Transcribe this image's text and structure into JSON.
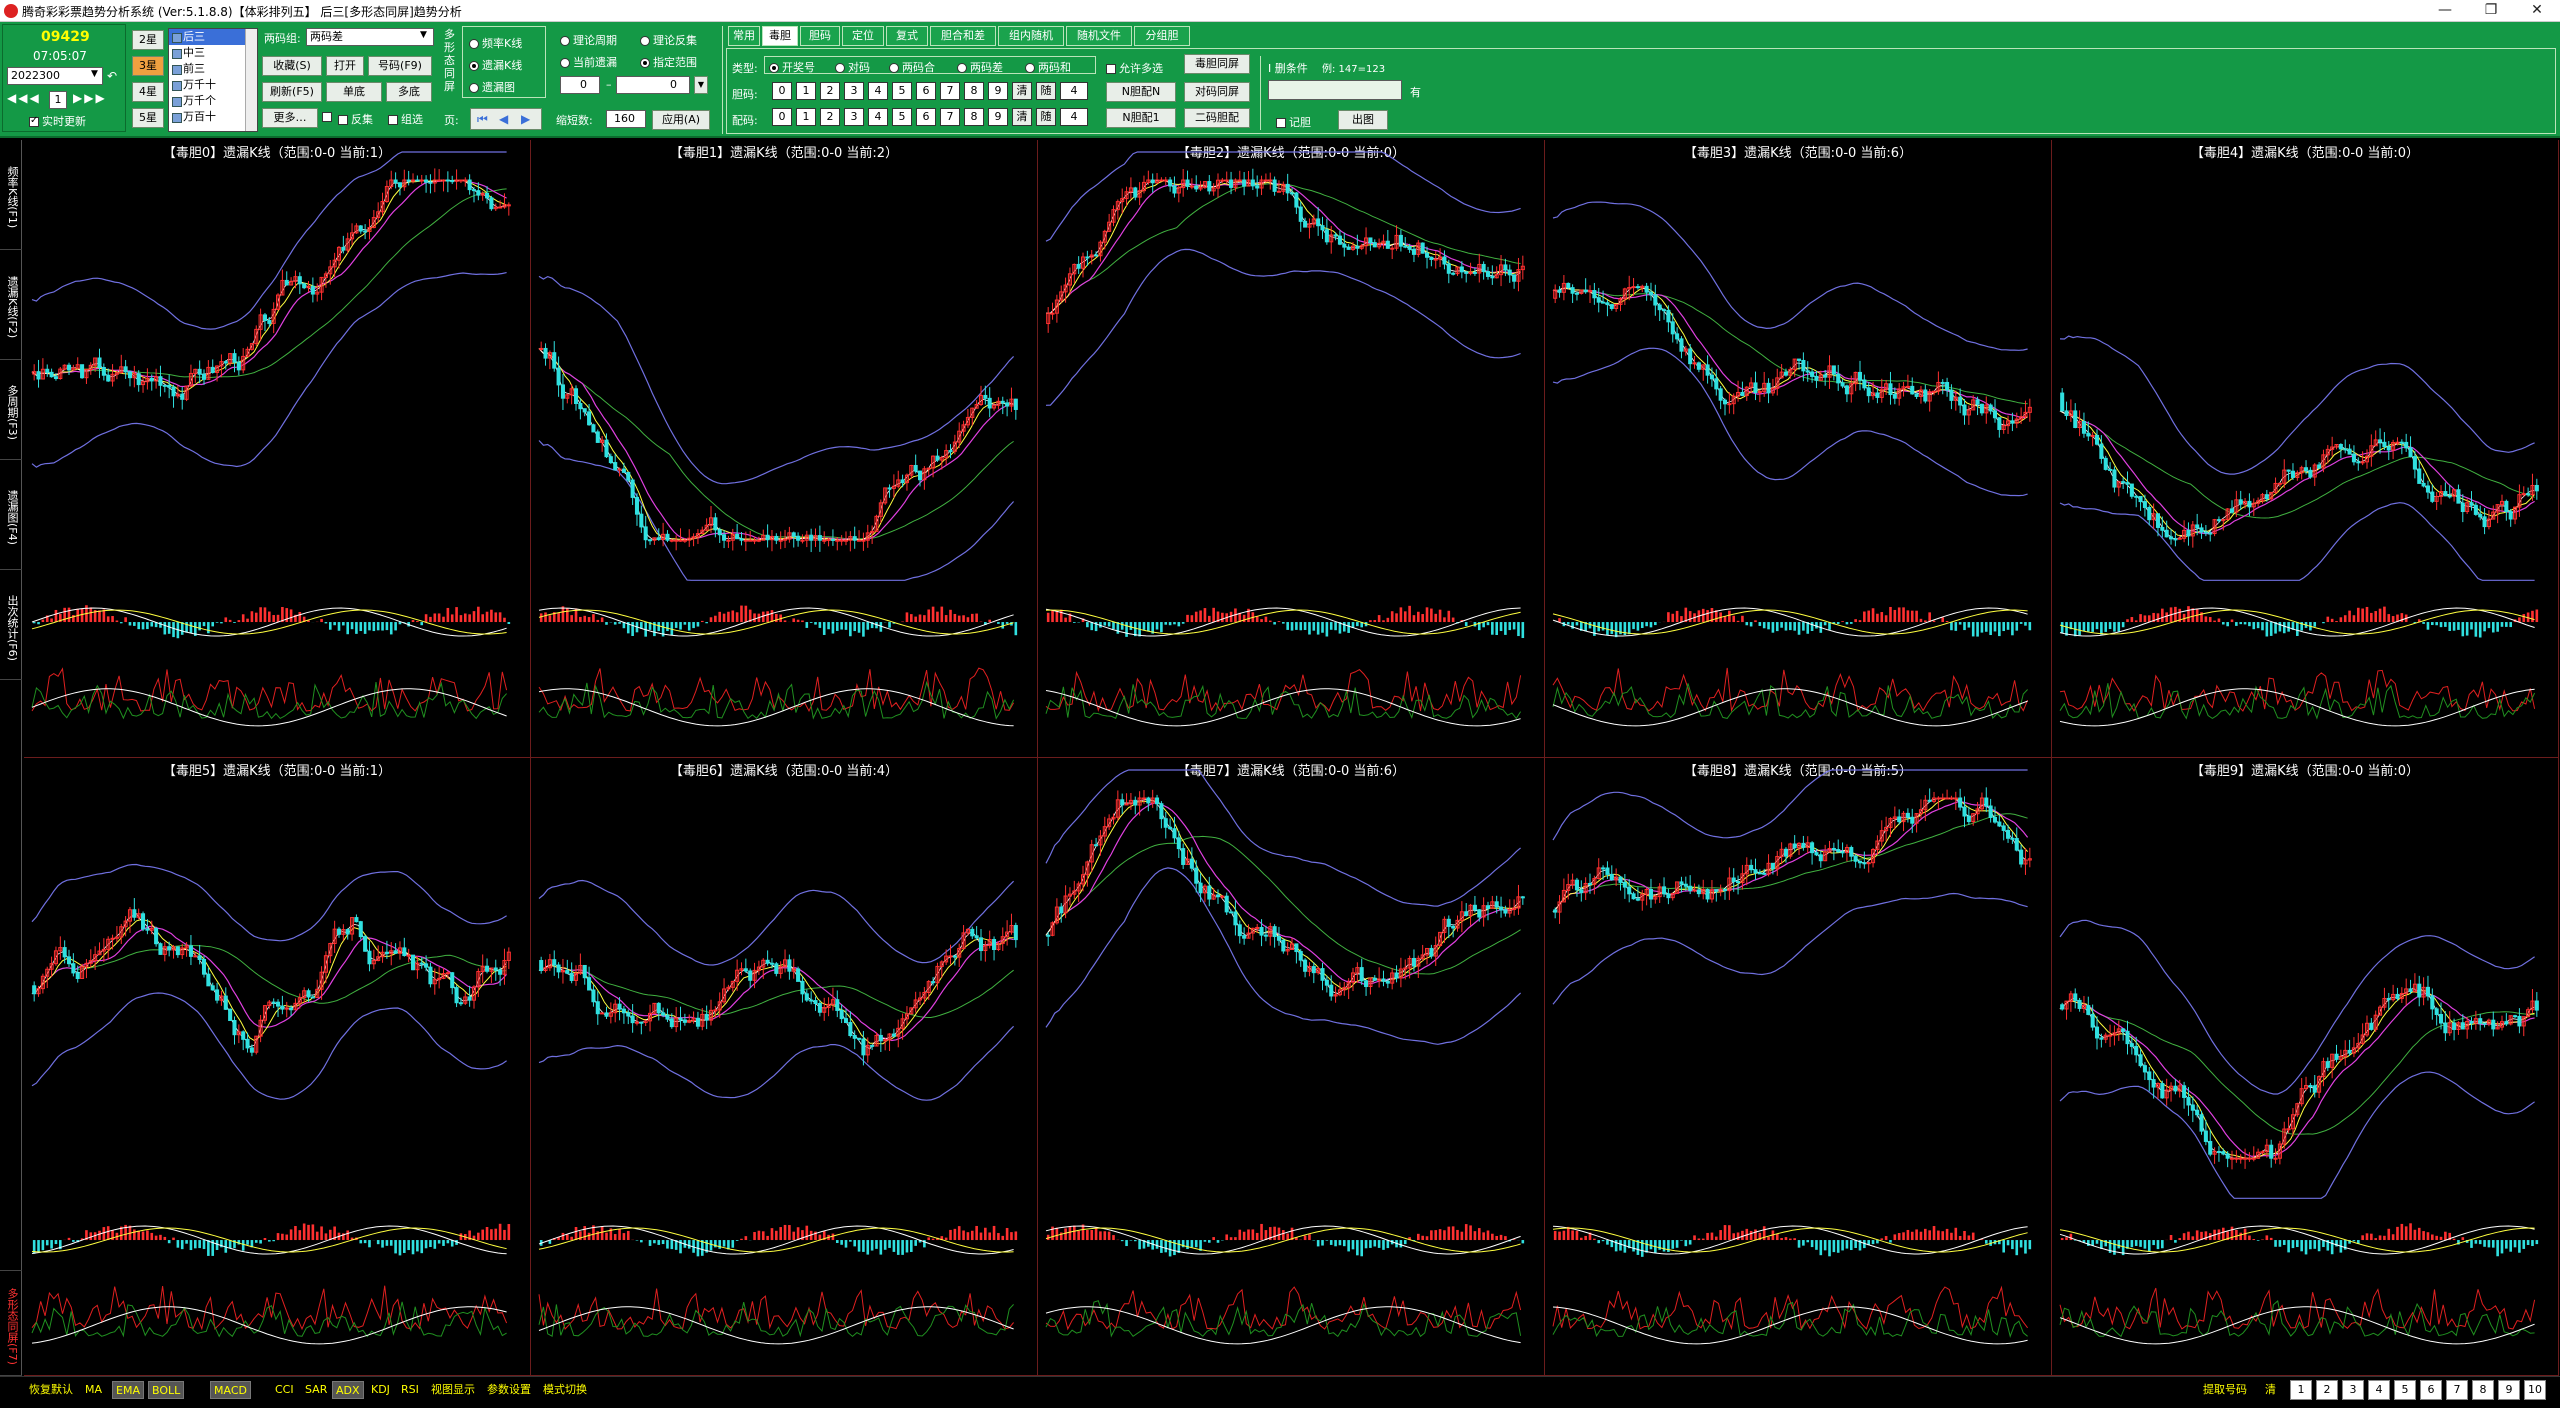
{
  "window": {
    "title": "腾奇彩彩票趋势分析系统 (Ver:5.1.8.8)【体彩排列五】   后三[多形态同屏]趋势分析",
    "minimize": "—",
    "restore": "❐",
    "close": "✕"
  },
  "toolbar": {
    "issue_number": "09429",
    "clock": "07:05:07",
    "period_value": "2022300",
    "page_value": "1",
    "realtime_label": "实时更新",
    "star_buttons": [
      "2星",
      "3星",
      "4星",
      "5星"
    ],
    "position_list": [
      "后三",
      "中三",
      "前三",
      "万千十",
      "万千个",
      "万百十"
    ],
    "two_code_group_label": "两码组:",
    "two_code_group_value": "两码差",
    "buttons": {
      "collect": "收藏(S)",
      "open": "打开",
      "number": "号码(F9)",
      "refresh": "刷新(F5)",
      "single": "单底",
      "multi": "多底",
      "more": "更多…",
      "reverse": "反集",
      "combine": "组选"
    },
    "form_label": "多形态同屏",
    "page_label": "页:",
    "chart_mode": {
      "option1": "频率K线",
      "option2": "遗漏K线",
      "option3": "遗漏图"
    },
    "range": {
      "opt_theory": "理论周期",
      "opt_current": "当前遗漏",
      "opt_reverse": "理论反集",
      "opt_fixed": "指定范围",
      "min": "0",
      "max": "0",
      "zoom_label": "缩短数:",
      "zoom_value": "160",
      "apply": "应用(A)"
    },
    "tabs": [
      "常用",
      "毒胆",
      "胆码",
      "定位",
      "复式",
      "胆合和差",
      "组内随机",
      "随机文件",
      "分组胆"
    ],
    "active_tab": "毒胆",
    "type_label": "类型:",
    "type_options": [
      "开奖号",
      "对码",
      "两码合",
      "两码差",
      "两码和"
    ],
    "allow_multi": "允许多选",
    "duodan_screen": "毒胆同屏",
    "bile_label": "胆码:",
    "match_label": "配码:",
    "digits": [
      "0",
      "1",
      "2",
      "3",
      "4",
      "5",
      "6",
      "7",
      "8",
      "9"
    ],
    "clear": "清",
    "random": "随",
    "spin_value": "4",
    "n_match_n": "N胆配N",
    "pair_screen": "对码同屏",
    "n_match_1": "N胆配1",
    "two_code_match": "二码胆配",
    "filter_label": "I 删条件",
    "filter_example": "例: 147=123",
    "filter_value": "",
    "have_label": "有",
    "remember": "记胆",
    "output": "出图"
  },
  "left_nav": [
    {
      "label": "频率K线(F1)",
      "color": "white"
    },
    {
      "label": "遗漏K线(F2)",
      "color": "white"
    },
    {
      "label": "多周期(F3)",
      "color": "white"
    },
    {
      "label": "遗漏图(F4)",
      "color": "white"
    },
    {
      "label": "出次统计(F6)",
      "color": "white"
    },
    {
      "label": "多形态同屏(F7)",
      "color": "red"
    }
  ],
  "panels": [
    {
      "title": "【毒胆0】遗漏K线（范围:0-0 当前:1）"
    },
    {
      "title": "【毒胆1】遗漏K线（范围:0-0 当前:2）"
    },
    {
      "title": "【毒胆2】遗漏K线（范围:0-0 当前:0）"
    },
    {
      "title": "【毒胆3】遗漏K线（范围:0-0 当前:6）"
    },
    {
      "title": "【毒胆4】遗漏K线（范围:0-0 当前:0）"
    },
    {
      "title": "【毒胆5】遗漏K线（范围:0-0 当前:1）"
    },
    {
      "title": "【毒胆6】遗漏K线（范围:0-0 当前:4）"
    },
    {
      "title": "【毒胆7】遗漏K线（范围:0-0 当前:6）"
    },
    {
      "title": "【毒胆8】遗漏K线（范围:0-0 当前:5）"
    },
    {
      "title": "【毒胆9】遗漏K线（范围:0-0 当前:0）"
    }
  ],
  "statusbar": {
    "items": [
      {
        "label": "恢复默认",
        "boxed": false
      },
      {
        "label": "MA",
        "boxed": false
      },
      {
        "label": "EMA",
        "boxed": true
      },
      {
        "label": "BOLL",
        "boxed": true
      },
      {
        "label": "MACD",
        "boxed": true
      },
      {
        "label": "CCI",
        "boxed": false
      },
      {
        "label": "SAR",
        "boxed": false
      },
      {
        "label": "ADX",
        "boxed": true
      },
      {
        "label": "KDJ",
        "boxed": false
      },
      {
        "label": "RSI",
        "boxed": false
      },
      {
        "label": "视图显示",
        "boxed": false
      },
      {
        "label": "参数设置",
        "boxed": false
      },
      {
        "label": "模式切换",
        "boxed": false
      }
    ],
    "fetch_label": "提取号码",
    "clear_label": "清",
    "pages": [
      "1",
      "2",
      "3",
      "4",
      "5",
      "6",
      "7",
      "8",
      "9",
      "10"
    ]
  },
  "colors": {
    "toolbar_bg": "#149946",
    "candle_up": "#ff3030",
    "candle_down": "#30e0e0",
    "ma_white": "#ffffff",
    "ma_yellow": "#ffff40",
    "ma_magenta": "#e040e0",
    "ma_green": "#40b040",
    "boll": "#7070e0",
    "panel_border": "#6b1c1c"
  }
}
